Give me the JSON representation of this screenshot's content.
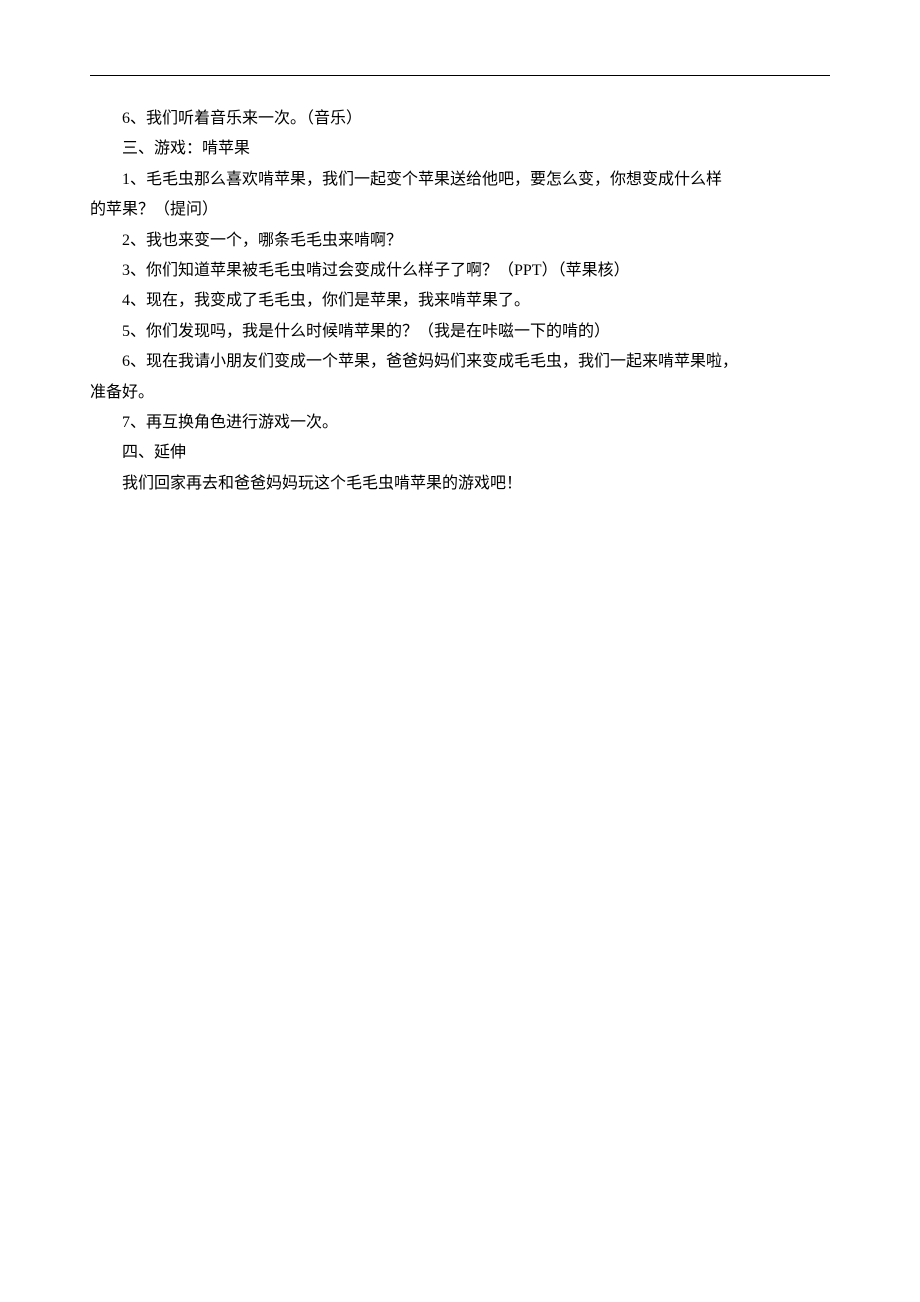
{
  "lines": [
    {
      "text": "6、我们听着音乐来一次。（音乐）",
      "indent": true
    },
    {
      "text": "三、游戏：啃苹果",
      "indent": true
    },
    {
      "text": "1、毛毛虫那么喜欢啃苹果，我们一起变个苹果送给他吧，要怎么变，你想变成什么样",
      "indent": true
    },
    {
      "text": "的苹果？（提问）",
      "indent": false
    },
    {
      "text": "2、我也来变一个，哪条毛毛虫来啃啊？",
      "indent": true
    },
    {
      "text": "3、你们知道苹果被毛毛虫啃过会变成什么样子了啊？（PPT）（苹果核）",
      "indent": true
    },
    {
      "text": "4、现在，我变成了毛毛虫，你们是苹果，我来啃苹果了。",
      "indent": true
    },
    {
      "text": "5、你们发现吗，我是什么时候啃苹果的？（我是在咔嗞一下的啃的）",
      "indent": true
    },
    {
      "text": "6、现在我请小朋友们变成一个苹果，爸爸妈妈们来变成毛毛虫，我们一起来啃苹果啦，",
      "indent": true
    },
    {
      "text": "准备好。",
      "indent": false
    },
    {
      "text": "7、再互换角色进行游戏一次。",
      "indent": true
    },
    {
      "text": "四、延伸",
      "indent": true
    },
    {
      "text": "我们回家再去和爸爸妈妈玩这个毛毛虫啃苹果的游戏吧！",
      "indent": true
    }
  ]
}
